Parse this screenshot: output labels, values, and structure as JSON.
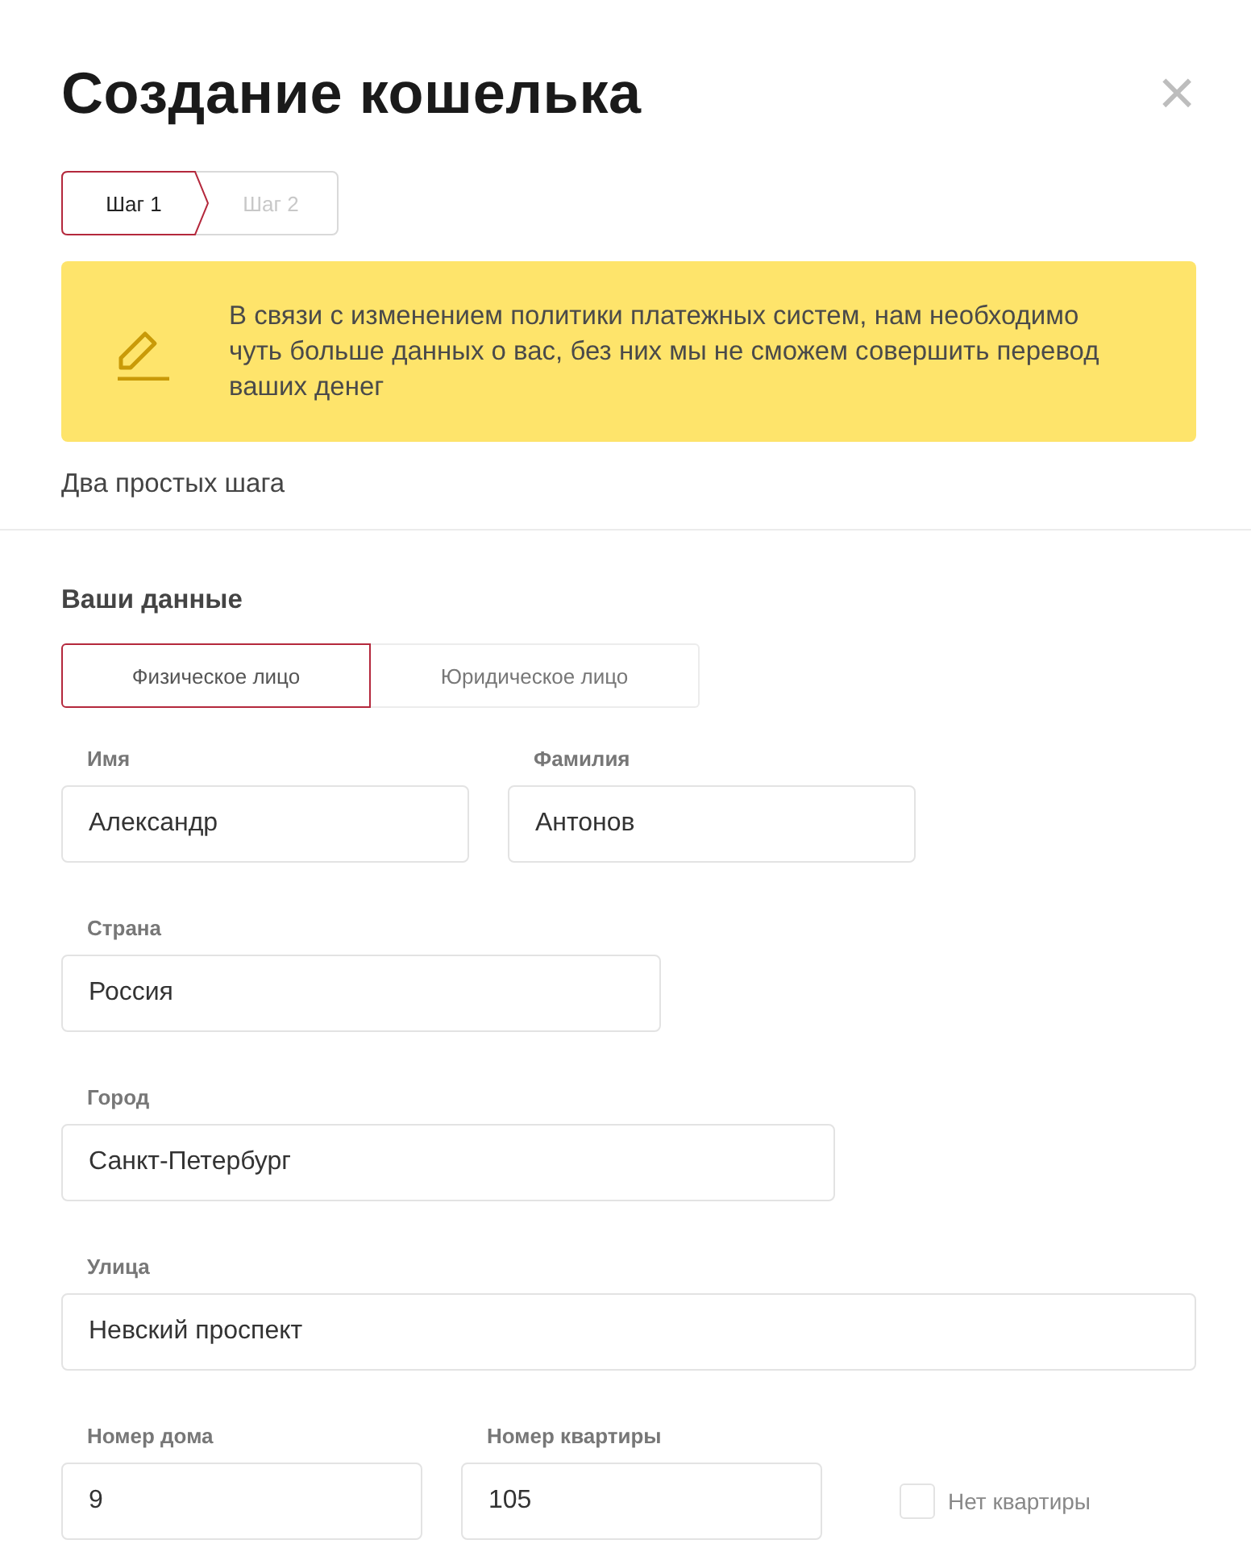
{
  "window": {
    "title": "Создание кошелька",
    "close": "×"
  },
  "steps": [
    {
      "label": "Шаг 1",
      "selected": true
    },
    {
      "label": "Шаг 2",
      "selected": false
    }
  ],
  "notice": {
    "text": "В связи с изменением политики платежных систем, нам необходимо чуть больше данных о вас, без них мы не сможем совершить перевод ваших денег"
  },
  "subtitle": "Два простых шага",
  "section": {
    "title": "Ваши данные"
  },
  "person_type": [
    {
      "label": "Физическое лицо",
      "selected": true
    },
    {
      "label": "Юридическое лицо",
      "selected": false
    }
  ],
  "form_rows": [
    [
      {
        "kind": "field",
        "label": "Имя",
        "value": "Александр"
      },
      {
        "kind": "field",
        "label": "Фамилия",
        "value": "Антонов"
      }
    ],
    [
      {
        "kind": "field",
        "label": "Страна",
        "value": "Россия"
      }
    ],
    [
      {
        "kind": "field",
        "label": "Город",
        "value": "Санкт-Петербург"
      }
    ],
    [
      {
        "kind": "field",
        "label": "Улица",
        "value": "Невский проспект"
      }
    ],
    [
      {
        "kind": "field",
        "label": "Номер дома",
        "value": "9"
      },
      {
        "kind": "field",
        "label": "Номер квартиры",
        "value": "105"
      },
      {
        "kind": "checkbox",
        "label": "Нет квартиры",
        "checked": false
      }
    ]
  ]
}
